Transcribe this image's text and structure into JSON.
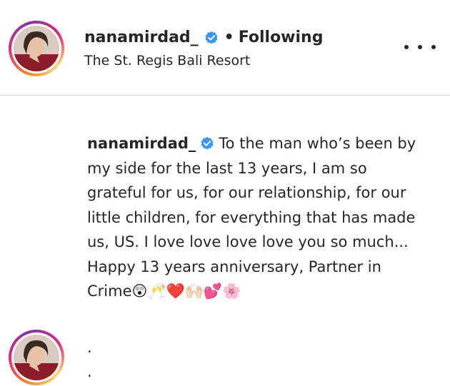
{
  "header": {
    "username": "nanamirdad_",
    "separator": "•",
    "follow_status": "Following",
    "location": "The St. Regis Bali Resort",
    "more_icon": "more-horizontal-icon"
  },
  "caption": {
    "username": "nanamirdad_",
    "text": "To the man who’s been by my side for the last 13 years, I am so grateful for us, for our relationship, for our little children, for everything that has made us, US. I love love love love you so much... Happy 13 years anniversary, Partner in Crime😲🥂❤️🙌🏻💕🌸",
    "trailing_lines": [
      ".",
      "."
    ]
  },
  "colors": {
    "text": "#262626",
    "verified": "#3897f0",
    "divider": "#e3e3e3"
  }
}
